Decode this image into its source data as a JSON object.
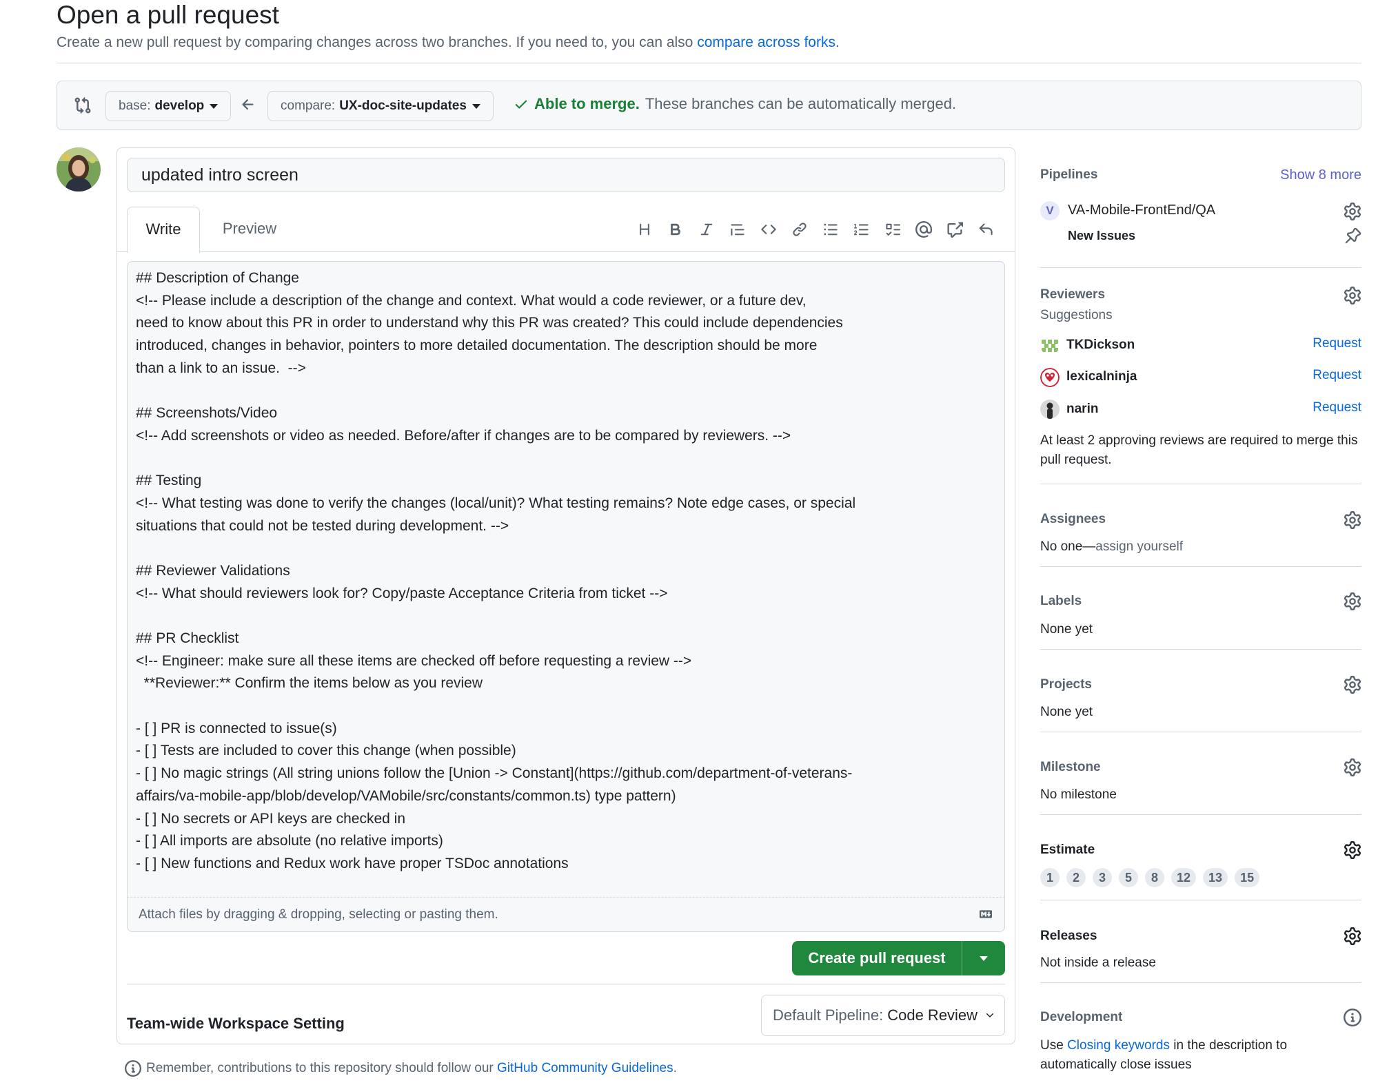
{
  "header": {
    "title": "Open a pull request",
    "subtitle": "Create a new pull request by comparing changes across two branches. If you need to, you can also",
    "forks_link": "compare across forks",
    "subtitle_end": "."
  },
  "branch_bar": {
    "base_prefix": "base:",
    "base_branch": "develop",
    "compare_prefix": "compare:",
    "compare_branch": "UX-doc-site-updates",
    "merge_status": "Able to merge.",
    "merge_message": "These branches can be automatically merged."
  },
  "editor": {
    "title_value": "updated intro screen",
    "tabs": {
      "write": "Write",
      "preview": "Preview"
    },
    "toolbar_icons": [
      "heading-icon",
      "bold-icon",
      "italic-icon",
      "quote-icon",
      "code-icon",
      "link-icon",
      "unordered-list-icon",
      "ordered-list-icon",
      "task-list-icon",
      "mention-icon",
      "cross-reference-icon",
      "reply-icon"
    ],
    "body_lines": [
      "## Description of Change",
      "<!-- Please include a description of the change and context. What would a code reviewer, or a future dev,",
      "need to know about this PR in order to understand why this PR was created? This could include dependencies",
      "introduced, changes in behavior, pointers to more detailed documentation. The description should be more",
      "than a link to an issue.  -->",
      "",
      "## Screenshots/Video",
      "<!-- Add screenshots or video as needed. Before/after if changes are to be compared by reviewers. -->",
      "",
      "## Testing",
      "<!-- What testing was done to verify the changes (local/unit)? What testing remains? Note edge cases, or special",
      "situations that could not be tested during development. -->",
      "",
      "## Reviewer Validations",
      "<!-- What should reviewers look for? Copy/paste Acceptance Criteria from ticket -->",
      "",
      "## PR Checklist",
      "<!-- Engineer: make sure all these items are checked off before requesting a review -->",
      "  **Reviewer:** Confirm the items below as you review",
      "",
      "- [ ] PR is connected to issue(s)",
      "- [ ] Tests are included to cover this change (when possible)",
      "- [ ] No magic strings (All string unions follow the [Union -> Constant](https://github.com/department-of-veterans-",
      "affairs/va-mobile-app/blob/develop/VAMobile/src/constants/common.ts) type pattern)",
      "- [ ] No secrets or API keys are checked in",
      "- [ ] All imports are absolute (no relative imports)",
      "- [ ] New functions and Redux work have proper TSDoc annotations"
    ],
    "attach_text": "Attach files by dragging & dropping, selecting or pasting them.",
    "create_button": "Create pull request",
    "team_setting_label": "Team-wide Workspace Setting",
    "pipeline_prefix": "Default Pipeline:",
    "pipeline_value": "Code Review"
  },
  "footer": {
    "note": "Remember, contributions to this repository should follow our",
    "guidelines_link": "GitHub Community Guidelines",
    "note_end": "."
  },
  "sidebar": {
    "pipelines": {
      "title": "Pipelines",
      "show_more": "Show 8 more",
      "badge": "V",
      "name": "VA-Mobile-FrontEnd/QA",
      "state": "New Issues"
    },
    "reviewers": {
      "title": "Reviewers",
      "suggestions_label": "Suggestions",
      "people": [
        {
          "name": "TKDickson",
          "action": "Request"
        },
        {
          "name": "lexicalninja",
          "action": "Request"
        },
        {
          "name": "narin",
          "action": "Request"
        }
      ],
      "note": "At least 2 approving reviews are required to merge this pull request."
    },
    "assignees": {
      "title": "Assignees",
      "body_prefix": "No one—",
      "assign_link": "assign yourself"
    },
    "labels": {
      "title": "Labels",
      "body": "None yet"
    },
    "projects": {
      "title": "Projects",
      "body": "None yet"
    },
    "milestone": {
      "title": "Milestone",
      "body": "No milestone"
    },
    "estimate": {
      "title": "Estimate",
      "values": [
        "1",
        "2",
        "3",
        "5",
        "8",
        "12",
        "13",
        "15"
      ]
    },
    "releases": {
      "title": "Releases",
      "body": "Not inside a release"
    },
    "development": {
      "title": "Development",
      "prefix": "Use",
      "link": "Closing keywords",
      "suffix": "in the description to automatically close issues"
    }
  },
  "colors": {
    "accent": "#0969da",
    "success": "#1a7f37",
    "button_green": "#1f883d",
    "pipeline_purple": "#5e60ce"
  }
}
